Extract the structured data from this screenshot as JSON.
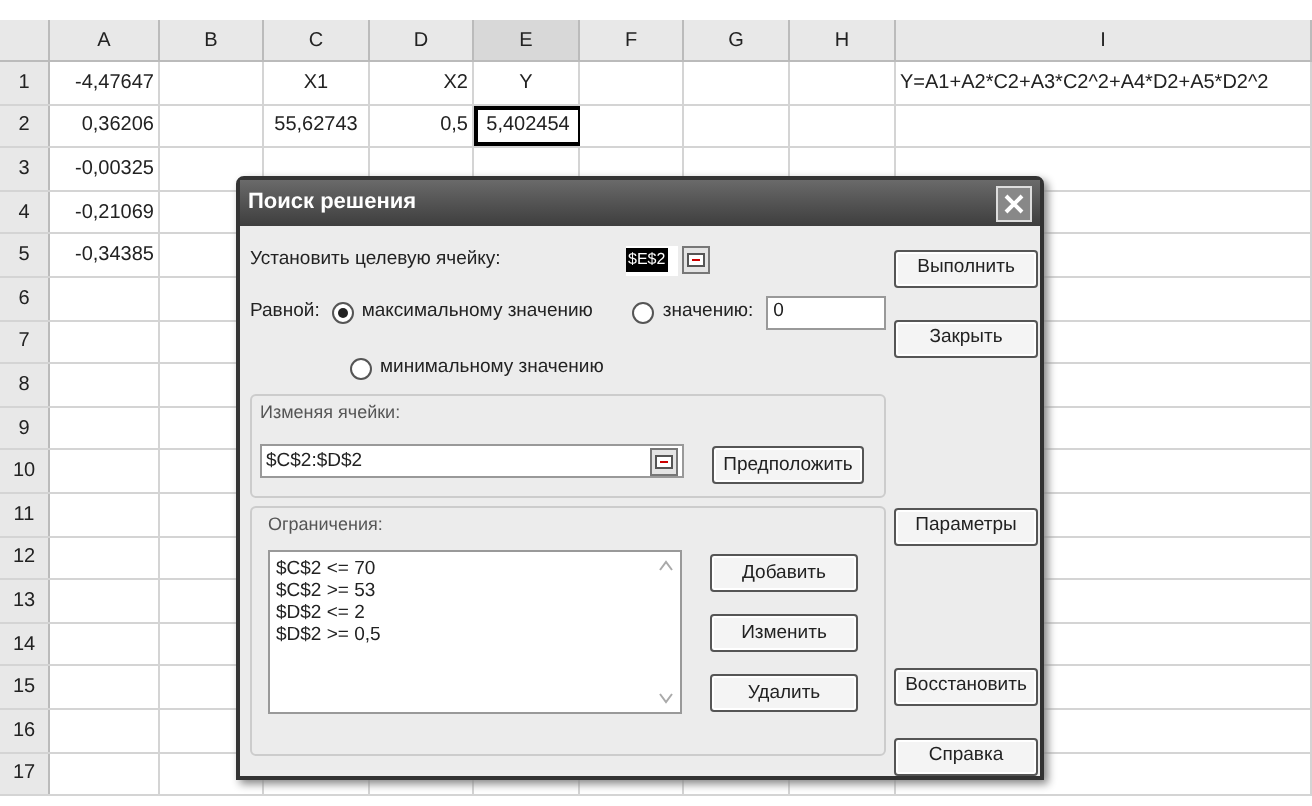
{
  "sheet": {
    "columns": [
      "A",
      "B",
      "C",
      "D",
      "E",
      "F",
      "G",
      "H",
      "I"
    ],
    "rows": [
      {
        "number": "1",
        "cells": [
          {
            "text": "-4,47647",
            "selected": false
          },
          {
            "text": "",
            "selected": false
          },
          {
            "text": "X1",
            "selected": false
          },
          {
            "text": "X2",
            "selected": false
          },
          {
            "text": "Y",
            "selected": false
          },
          {
            "text": "",
            "selected": false
          },
          {
            "text": "",
            "selected": false
          },
          {
            "text": "",
            "selected": false
          },
          {
            "text": "Y=A1+A2*C2+A3*C2^2+A4*D2+A5*D2^2",
            "selected": false
          }
        ]
      },
      {
        "number": "2",
        "cells": [
          {
            "text": "0,36206",
            "selected": false
          },
          {
            "text": "",
            "selected": false
          },
          {
            "text": "55,62743",
            "selected": false
          },
          {
            "text": "0,5",
            "selected": false
          },
          {
            "text": "5,402454",
            "selected": true
          }
        ]
      },
      {
        "number": "3",
        "cells": [
          {
            "text": "-0,00325",
            "selected": false
          }
        ]
      },
      {
        "number": "4",
        "cells": [
          {
            "text": "-0,21069",
            "selected": false
          }
        ]
      },
      {
        "number": "5",
        "cells": [
          {
            "text": "-0,34385",
            "selected": false
          }
        ]
      },
      {
        "number": "6"
      },
      {
        "number": "7"
      },
      {
        "number": "8"
      },
      {
        "number": "9"
      },
      {
        "number": "10"
      },
      {
        "number": "11"
      },
      {
        "number": "12"
      },
      {
        "number": "13"
      },
      {
        "number": "14"
      },
      {
        "number": "15"
      },
      {
        "number": "16"
      },
      {
        "number": "17"
      }
    ]
  },
  "dialog": {
    "title": "Поиск решения",
    "target_label": "Установить целевую ячейку:",
    "target_value": "$E$2",
    "equal_label": "Равной:",
    "options": [
      {
        "label": "максимальному значению",
        "selected": true
      },
      {
        "label": "значению:",
        "selected": false
      },
      {
        "label": "минимальному значению",
        "selected": false
      }
    ],
    "value_field": "0",
    "changing_label": "Изменяя ячейки:",
    "changing_value": "$C$2:$D$2",
    "guess_button": "Предположить",
    "constraints_label": "Ограничения:",
    "constraints": [
      "$C$2 <= 70",
      "$C$2 >= 53",
      "$D$2 <= 2",
      "$D$2 >= 0,5"
    ],
    "constraint_buttons": [
      "Добавить",
      "Изменить",
      "Удалить"
    ],
    "side_buttons": [
      "Выполнить",
      "Закрыть",
      "Параметры",
      "Восстановить",
      "Справка"
    ]
  }
}
